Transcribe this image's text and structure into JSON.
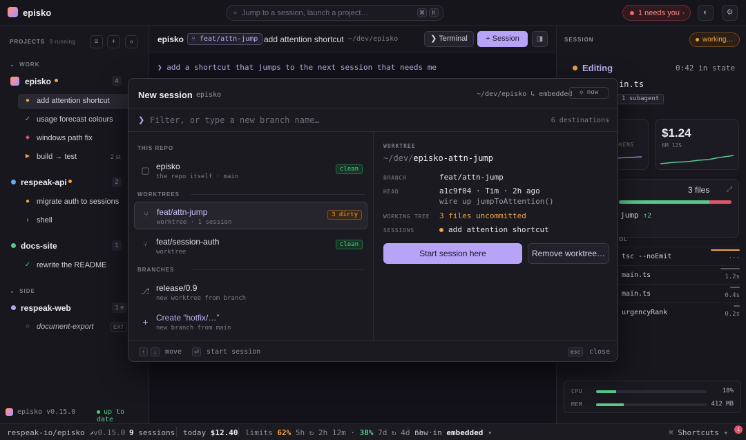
{
  "app": {
    "name": "episko"
  },
  "search": {
    "placeholder": "Jump to a session, launch a project…",
    "k1": "⌘",
    "k2": "K"
  },
  "needs": {
    "label": "1 needs you",
    "chev": "›"
  },
  "sidebar": {
    "header": "PROJECTS",
    "running": "9 running",
    "groups": {
      "work": "WORK",
      "side": "SIDE"
    },
    "projects": [
      {
        "name": "episko",
        "count": "4",
        "color": "#7aa7ff",
        "sessions": [
          {
            "label": "add attention shortcut",
            "icon": "●",
            "icon_color": "#f0a343",
            "active": true
          },
          {
            "label": "usage forecast colours",
            "icon": "✓",
            "icon_color": "#58c98a"
          },
          {
            "label": "windows path fix",
            "icon": "◆",
            "icon_color": "#e0556a"
          },
          {
            "label": "build → test",
            "icon": "▶",
            "icon_color": "#f0a343",
            "extra": "2 st"
          }
        ]
      },
      {
        "name": "respeak-api",
        "count": "2",
        "color": "#6aa8f0",
        "sessions": [
          {
            "label": "migrate auth to sessions",
            "icon": "●",
            "icon_color": "#f0a343"
          },
          {
            "label": "shell",
            "icon": "›",
            "icon_color": "#b5b3c0"
          }
        ]
      },
      {
        "name": "docs-site",
        "count": "1",
        "color": "#58c98a",
        "sessions": [
          {
            "label": "rewrite the README",
            "icon": "✓",
            "icon_color": "#58c98a"
          }
        ]
      },
      {
        "name": "respeak-web",
        "count": "1 e",
        "color": "#b7a4f6",
        "sessions": [
          {
            "label": "document-export",
            "icon": "○",
            "icon_color": "#8d8b98",
            "ext": "EXT"
          }
        ]
      }
    ],
    "footer": {
      "version": "episko v0.15.0",
      "update": "up to date"
    }
  },
  "center": {
    "project": "episko",
    "branch": "feat/attn-jump",
    "title": "add attention shortcut",
    "path": "~/dev/episko",
    "terminal": "❯ Terminal",
    "session": "+ Session",
    "prompt": "❯ add a shortcut that jumps to the next session that needs me"
  },
  "modal": {
    "title": "New session",
    "project": "episko",
    "path": "~/dev/episko ↳ embedded",
    "now": "◇ now",
    "filter_placeholder": "Filter, or type a new branch name…",
    "destinations": "6 destinations",
    "sections": {
      "repo": "THIS REPO",
      "worktrees": "WORKTREES",
      "branches": "BRANCHES"
    },
    "repo": {
      "name": "episko",
      "sub": "the repo itself · main",
      "badge": "clean"
    },
    "worktrees": [
      {
        "name": "feat/attn-jump",
        "sub": "worktree · 1 session",
        "badge": "3 dirty",
        "selected": true
      },
      {
        "name": "feat/session-auth",
        "sub": "worktree",
        "badge": "clean"
      }
    ],
    "branches": [
      {
        "name": "release/0.9",
        "sub": "new worktree from branch",
        "icon": "⎇"
      },
      {
        "name": "Create “hotfix/…”",
        "sub": "new branch from main",
        "icon": "+"
      }
    ],
    "detail": {
      "heading": "WORKTREE",
      "path_dim": "~/dev/",
      "path_name": "episko-attn-jump",
      "branch_k": "BRANCH",
      "branch_v": "feat/attn-jump",
      "head_k": "HEAD",
      "head_v": "a1c9f04 · Tim · 2h ago",
      "head_msg": "wire up jumpToAttention()",
      "tree_k": "WORKING TREE",
      "tree_v": "3 files uncommitted",
      "sessions_k": "SESSIONS",
      "sessions_v": "add attention shortcut",
      "start": "Start session here",
      "remove": "Remove worktree…"
    },
    "footer": {
      "move": "move",
      "start": "start session",
      "esc": "esc",
      "close": "close",
      "enter": "⏎"
    }
  },
  "right": {
    "header": "SESSION",
    "status": "working…",
    "state": "Editing",
    "state_time": "0:42 in state",
    "file": "in.ts",
    "subagent": "1 subagent",
    "tokens_label": "OKENS",
    "cost": "$1.24",
    "cost_sub": "6M 12S",
    "files": "3 files",
    "jump": "jump",
    "jump_n": "↑2",
    "tool_head": "OL",
    "tools": [
      {
        "name": "tsc --noEmit",
        "time": "···",
        "active": true,
        "fill": 1.0
      },
      {
        "name": "main.ts",
        "time": "1.2s",
        "fill": 0.6
      },
      {
        "name": "main.ts",
        "time": "0.4s",
        "fill": 0.25
      },
      {
        "name": "urgencyRank",
        "time": "0.2s",
        "fill": 0.2
      }
    ],
    "cpu_label": "CPU",
    "cpu": "18%",
    "cpu_fill": 0.18,
    "mem_label": "MEM",
    "mem": "412 MB",
    "mem_fill": 0.25
  },
  "status": {
    "repo": "respeak-io/episko ↗",
    "version": "v0.15.0",
    "sessions_n": "9",
    "sessions_l": "sessions",
    "today_l": "today",
    "today_v": "$12.40",
    "limits_l": "limits",
    "l1": "62%",
    "l1_rest": "5h ↻ 2h 12m ·",
    "l2": "38%",
    "l2_rest": "7d ↻ 4d 6h ·",
    "new_l": "new in",
    "new_v": "embedded",
    "shortcuts": "Shortcuts",
    "notif": "1"
  },
  "colors": {
    "accent": "#b7a4f6",
    "ok": "#58c98a",
    "warn": "#f0a343",
    "err": "#e0556a"
  }
}
